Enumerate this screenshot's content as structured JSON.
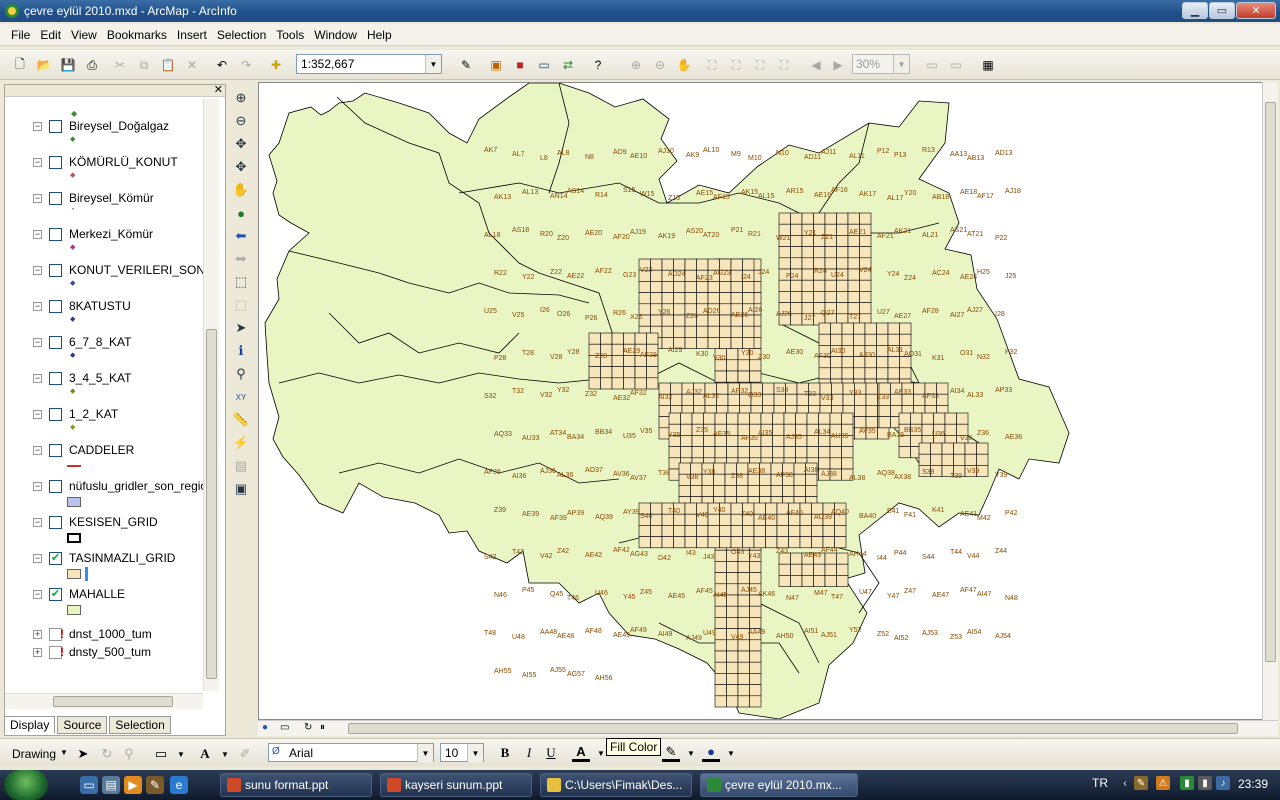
{
  "window": {
    "title": "çevre eylül 2010.mxd - ArcMap - ArcInfo",
    "controls": [
      "minimize",
      "maximize",
      "close"
    ]
  },
  "menu": [
    "File",
    "Edit",
    "View",
    "Bookmarks",
    "Insert",
    "Selection",
    "Tools",
    "Window",
    "Help"
  ],
  "toolbar": {
    "scale": "1:352,667",
    "zoom_percent": "30%"
  },
  "toc": {
    "layers": [
      {
        "name": "Bireysel_Doğalgaz",
        "checked": false,
        "symbol": "diamond",
        "color": "#3a8a2a"
      },
      {
        "name": "KÖMÜRLÜ_KONUT",
        "checked": false,
        "symbol": "diamond",
        "color": "#c05050"
      },
      {
        "name": "Bireysel_Kömür",
        "checked": false,
        "symbol": "dot",
        "color": "#6070b0"
      },
      {
        "name": "Merkezi_Kömür",
        "checked": false,
        "symbol": "diamond",
        "color": "#b03070"
      },
      {
        "name": "KONUT_VERILERI_SON2",
        "checked": false,
        "symbol": "diamond",
        "color": "#2a4ab0"
      },
      {
        "name": "8KATUSTU",
        "checked": false,
        "symbol": "diamond",
        "color": "#2a3a90"
      },
      {
        "name": "6_7_8_KAT",
        "checked": false,
        "symbol": "diamond",
        "color": "#2a3a90"
      },
      {
        "name": "3_4_5_KAT",
        "checked": false,
        "symbol": "diamond",
        "color": "#6a8a20"
      },
      {
        "name": "1_2_KAT",
        "checked": false,
        "symbol": "diamond",
        "color": "#8a9a20"
      },
      {
        "name": "CADDELER",
        "checked": false,
        "symbol": "line",
        "color": "#c03030"
      },
      {
        "name": "nüfuslu_gridler_son_region",
        "checked": false,
        "symbol": "fill",
        "color": "#b8c4ec"
      },
      {
        "name": "KESISEN_GRID",
        "checked": false,
        "symbol": "outline",
        "color": "#000000"
      },
      {
        "name": "TASINMAZLI_GRID",
        "checked": true,
        "symbol": "fill",
        "color": "#f6e4b8"
      },
      {
        "name": "MAHALLE",
        "checked": true,
        "symbol": "fill",
        "color": "#e8f5c0"
      },
      {
        "name": "dnst_1000_tum",
        "checked": false,
        "symbol": "none",
        "color": "#c00000"
      },
      {
        "name": "dnsty_500_tum",
        "checked": false,
        "symbol": "none",
        "color": "#c00000"
      }
    ],
    "tabs": [
      "Display",
      "Source",
      "Selection"
    ]
  },
  "drawing_toolbar": {
    "drawing_label": "Drawing",
    "font": "Arial",
    "font_size": "10",
    "bold": "B",
    "italic": "I",
    "underline": "U",
    "tooltip": "Fill Color"
  },
  "map": {
    "fill_color": "#eaf5c4",
    "grid_color": "#f7e6bc",
    "labels": [
      "AK7",
      "AL7",
      "L8",
      "AL8",
      "N8",
      "AD9",
      "AE10",
      "AJ10",
      "AK9",
      "AL10",
      "M9",
      "M10",
      "N10",
      "AD11",
      "AJ11",
      "AL11",
      "P12",
      "P13",
      "R13",
      "AA13",
      "AB13",
      "AD13",
      "AK13",
      "AL13",
      "AN14",
      "AS14",
      "R14",
      "S15",
      "W15",
      "Z15",
      "AE15",
      "AF15",
      "AK15",
      "AL15",
      "AR15",
      "AE16",
      "AF16",
      "AK17",
      "AL17",
      "Y20",
      "AB18",
      "AE18",
      "AF17",
      "AJ18",
      "AL18",
      "AS18",
      "R20",
      "Z20",
      "AE20",
      "AF20",
      "AJ19",
      "AK19",
      "AS20",
      "AT20",
      "P21",
      "R21",
      "W21",
      "Y21",
      "Z21",
      "AE21",
      "AF21",
      "AK21",
      "AL21",
      "AS21",
      "AT21",
      "P22",
      "R22",
      "Y22",
      "Z22",
      "AE22",
      "AF22",
      "G23",
      "V23",
      "AD24",
      "AF23",
      "AG23",
      "I24",
      "J24",
      "P24",
      "R24",
      "U24",
      "V24",
      "Y24",
      "Z24",
      "AC24",
      "AE24",
      "H25",
      "J25",
      "U25",
      "V25",
      "I26",
      "O26",
      "P26",
      "R26",
      "X26",
      "Y26",
      "Z26",
      "AD26",
      "AE26",
      "AI26",
      "AJ26",
      "J27",
      "Q27",
      "T27",
      "U27",
      "AE27",
      "AF28",
      "AI27",
      "AJ27",
      "I28",
      "P28",
      "T28",
      "V28",
      "Y28",
      "Z28",
      "AE29",
      "AF29",
      "AI29",
      "K30",
      "V30",
      "Y30",
      "Z30",
      "AE30",
      "AF30",
      "AI30",
      "AJ30",
      "AL31",
      "AO31",
      "K31",
      "O31",
      "N32",
      "P32",
      "S32",
      "T32",
      "V32",
      "Y32",
      "Z32",
      "AE32",
      "AF32",
      "AI32",
      "AJ32",
      "AL32",
      "AP32",
      "Q33",
      "S33",
      "T33",
      "V33",
      "Y33",
      "Z33",
      "AE33",
      "AF33",
      "AI34",
      "AL33",
      "AP33",
      "AQ33",
      "AU33",
      "AT34",
      "BA34",
      "BB34",
      "U35",
      "V35",
      "Y35",
      "Z35",
      "AE35",
      "AF35",
      "AI35",
      "AJ35",
      "AL34",
      "AU35",
      "AV35",
      "BA35",
      "BB35",
      "U36",
      "V36",
      "Z36",
      "AE36",
      "AF36",
      "AI36",
      "AJ36",
      "AL36",
      "AO37",
      "AV36",
      "AV37",
      "T38",
      "V38",
      "Y38",
      "Z38",
      "AE38",
      "AF38",
      "AI38",
      "AJ38",
      "AL38",
      "AQ38",
      "AX38",
      "S39",
      "T39",
      "V39",
      "Y39",
      "Z39",
      "AE39",
      "AF39",
      "AP39",
      "AQ39",
      "AY39",
      "S40",
      "T40",
      "V40",
      "Y40",
      "Z40",
      "AE40",
      "AF40",
      "AO39",
      "AQ40",
      "BA40",
      "E41",
      "F41",
      "K41",
      "AE41",
      "M42",
      "P42",
      "S42",
      "T42",
      "V42",
      "Z42",
      "AE42",
      "AF42",
      "AG43",
      "D42",
      "I43",
      "J43",
      "O43",
      "Y43",
      "Z43",
      "AE43",
      "AF44",
      "AH44",
      "I44",
      "P44",
      "S44",
      "T44",
      "V44",
      "Z44",
      "N46",
      "P45",
      "Q45",
      "T46",
      "U46",
      "Y45",
      "Z45",
      "AE45",
      "AF45",
      "AI45",
      "AJ45",
      "AK46",
      "N47",
      "M47",
      "T47",
      "U47",
      "Y47",
      "Z47",
      "AE47",
      "AF47",
      "AI47",
      "N48",
      "T48",
      "U48",
      "AA48",
      "AE48",
      "AF48",
      "AE49",
      "AF49",
      "AI49",
      "AJ49",
      "U49",
      "V49",
      "AA49",
      "AH50",
      "AI51",
      "AJ51",
      "Y52",
      "Z52",
      "AI52",
      "AJ53",
      "Z53",
      "AI54",
      "AJ54",
      "AH55",
      "AI55",
      "AJ55",
      "AG57",
      "AH56"
    ]
  },
  "taskbar": {
    "items": [
      {
        "label": "sunu format.ppt",
        "active": false
      },
      {
        "label": "kayseri sunum.ppt",
        "active": false
      },
      {
        "label": "C:\\Users\\Fimak\\Des...",
        "active": false
      },
      {
        "label": "çevre eylül 2010.mx...",
        "active": true
      }
    ],
    "lang": "TR",
    "clock": "23:39"
  }
}
